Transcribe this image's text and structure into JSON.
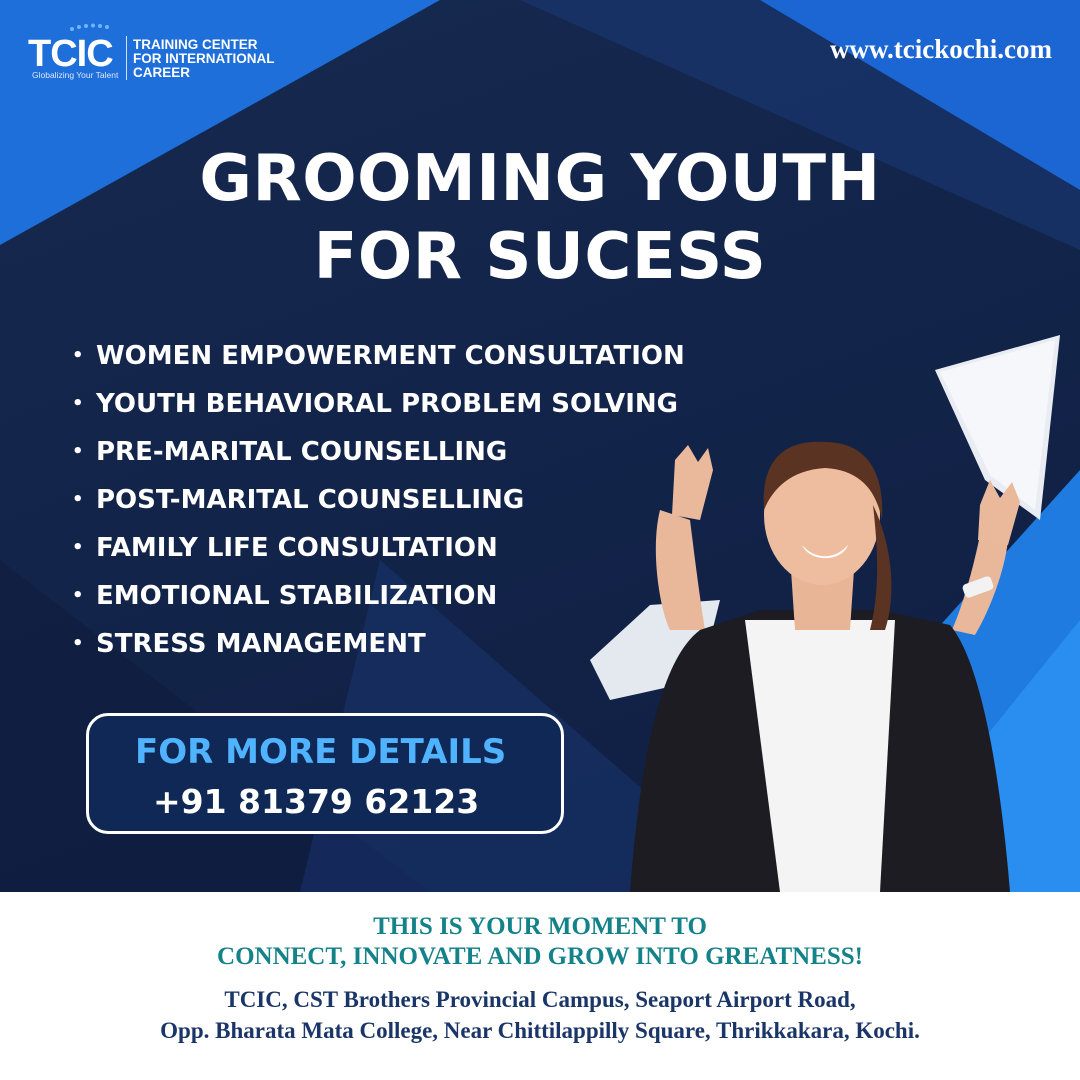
{
  "brand": {
    "logo_word": "TCIC",
    "logo_tagline": "Globalizing Your Talent",
    "name_lines": [
      "TRAINING CENTER",
      "FOR INTERNATIONAL",
      "CAREER"
    ],
    "website": "www.tcickochi.com"
  },
  "headline": [
    "GROOMING YOUTH",
    "FOR SUCESS"
  ],
  "services": [
    "WOMEN EMPOWERMENT CONSULTATION",
    "YOUTH BEHAVIORAL PROBLEM SOLVING",
    "PRE-MARITAL COUNSELLING",
    "POST-MARITAL COUNSELLING",
    "FAMILY LIFE CONSULTATION",
    "EMOTIONAL STABILIZATION",
    "STRESS MANAGEMENT"
  ],
  "contact": {
    "title": "FOR MORE DETAILS",
    "phone": "+91 81379 62123"
  },
  "footer": {
    "tagline": [
      "THIS IS YOUR MOMENT TO",
      "CONNECT, INNOVATE AND GROW INTO GREATNESS!"
    ],
    "address": [
      "TCIC, CST Brothers Provincial Campus, Seaport Airport Road,",
      "Opp. Bharata Mata College, Near Chittilappilly Square, Thrikkakara, Kochi."
    ]
  },
  "colors": {
    "navy": "#13244a",
    "accent_blue": "#1e6fd9",
    "cta_blue": "#4fb3ff",
    "footer_teal": "#138289",
    "footer_navy": "#1a3568"
  }
}
